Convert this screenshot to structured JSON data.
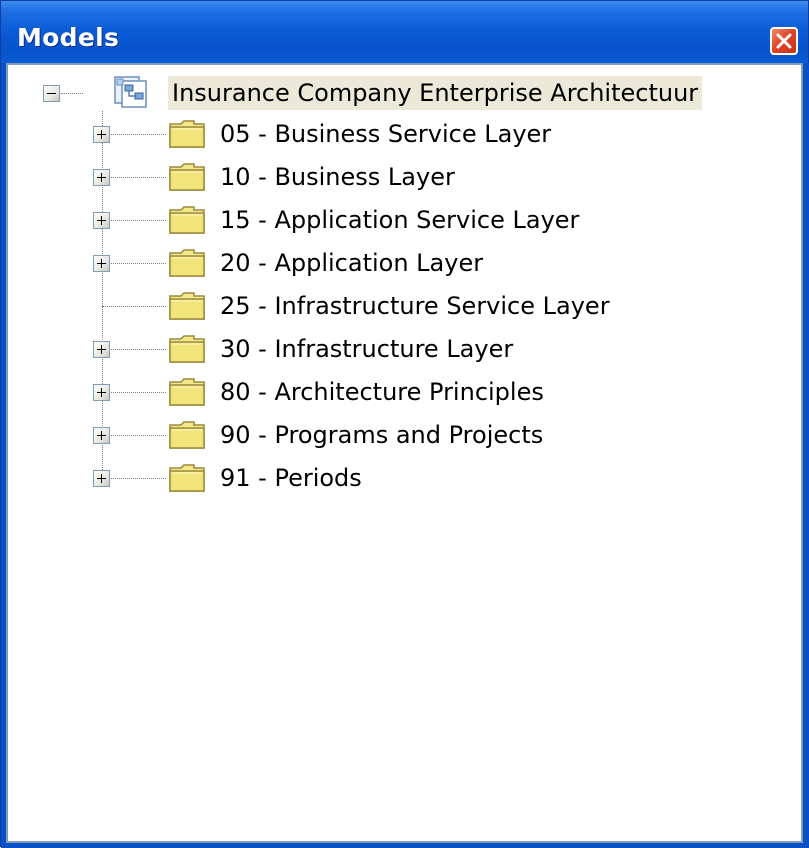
{
  "window": {
    "title": "Models"
  },
  "tree": {
    "root": {
      "label": "Insurance Company Enterprise Architectuur",
      "expanded": true,
      "icon": "model-icon"
    },
    "children": [
      {
        "label": "05 - Business Service Layer",
        "has_children": true,
        "icon": "folder-icon"
      },
      {
        "label": "10 - Business Layer",
        "has_children": true,
        "icon": "folder-icon"
      },
      {
        "label": "15 - Application Service Layer",
        "has_children": true,
        "icon": "folder-icon"
      },
      {
        "label": "20 - Application Layer",
        "has_children": true,
        "icon": "folder-icon"
      },
      {
        "label": "25 - Infrastructure Service Layer",
        "has_children": false,
        "icon": "folder-icon"
      },
      {
        "label": "30 - Infrastructure Layer",
        "has_children": true,
        "icon": "folder-icon"
      },
      {
        "label": "80 - Architecture Principles",
        "has_children": true,
        "icon": "folder-icon"
      },
      {
        "label": "90 - Programs and Projects",
        "has_children": true,
        "icon": "folder-icon"
      },
      {
        "label": "91 - Periods",
        "has_children": true,
        "icon": "folder-icon"
      }
    ]
  },
  "colors": {
    "titlebar": "#0a5bd6",
    "folder_fill": "#f2e98c",
    "selection": "#ece9d8",
    "close_button": "#e0462a"
  }
}
